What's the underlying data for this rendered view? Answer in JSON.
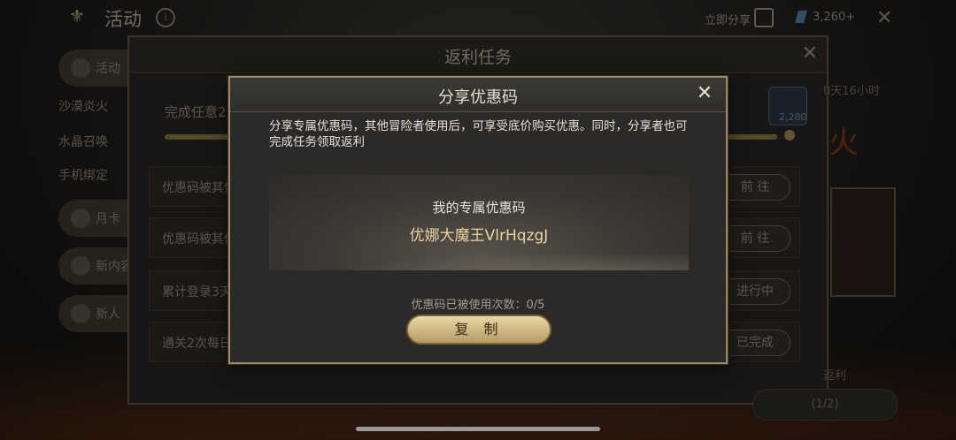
{
  "topbar": {
    "title": "活动",
    "info_icon": "i",
    "share_label": "立即分享",
    "currency": "3,260+",
    "close_icon": "✕"
  },
  "sidebar": {
    "items": [
      {
        "label": "活动"
      },
      {
        "label": "沙漠炎火"
      },
      {
        "label": "水晶召唤"
      },
      {
        "label": "手机绑定"
      },
      {
        "label": "月卡"
      },
      {
        "label": "新内容"
      },
      {
        "label": "新人"
      }
    ]
  },
  "background_panel": {
    "title": "返利任务",
    "progress_label": "完成任意2",
    "progress_fraction": 0.98,
    "reward_count": "2,280",
    "tasks": [
      {
        "label": "优惠码被其他",
        "button": "前 往"
      },
      {
        "label": "优惠码被其他",
        "button": "前 往"
      },
      {
        "label": "累计登录3天",
        "button": "进行中"
      },
      {
        "label": "通关2次每日",
        "button": "已完成"
      }
    ],
    "right_timer": "0天16小时",
    "right_char": "火",
    "right_note": "返利",
    "bottom_button": "(1/2)"
  },
  "modal": {
    "title": "分享优惠码",
    "description": "分享专属优惠码，其他冒险者使用后，可享受底价购买优惠。同时，分享者也可完成任务领取返利",
    "code_heading": "我的专属优惠码",
    "code_value": "优娜大魔王VlrHqzgJ",
    "usage_text": "优惠码已被使用次数：0/5",
    "copy_button": "复 制"
  },
  "colors": {
    "accent_gold": "#b59a63",
    "code_text": "#e9d3a0",
    "modal_border": "#9c8a62"
  },
  "icons": {
    "close": "close-icon",
    "info": "info-icon",
    "share": "share-icon",
    "gem": "gem-icon"
  }
}
